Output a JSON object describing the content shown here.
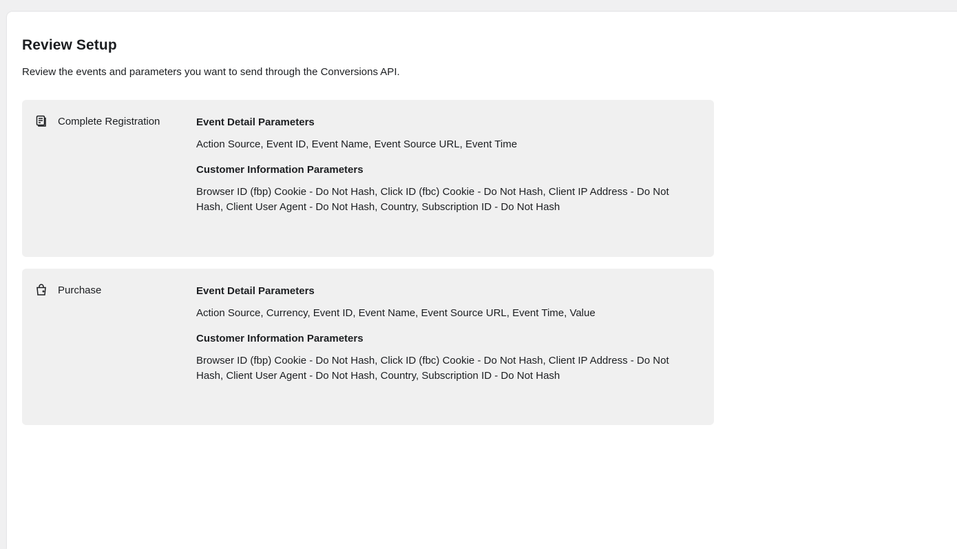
{
  "page": {
    "title": "Review Setup",
    "subtitle": "Review the events and parameters you want to send through the Conversions API."
  },
  "events": [
    {
      "name": "Complete Registration",
      "icon": "registration-form-icon",
      "event_detail_heading": "Event Detail Parameters",
      "event_detail_values": "Action Source, Event ID, Event Name, Event Source URL, Event Time",
      "customer_info_heading": "Customer Information Parameters",
      "customer_info_values": "Browser ID (fbp) Cookie - Do Not Hash, Click ID (fbc) Cookie - Do Not Hash, Client IP Address - Do Not Hash, Client User Agent - Do Not Hash, Country, Subscription ID - Do Not Hash"
    },
    {
      "name": "Purchase",
      "icon": "shopping-bag-icon",
      "event_detail_heading": "Event Detail Parameters",
      "event_detail_values": "Action Source, Currency, Event ID, Event Name, Event Source URL, Event Time, Value",
      "customer_info_heading": "Customer Information Parameters",
      "customer_info_values": "Browser ID (fbp) Cookie - Do Not Hash, Click ID (fbc) Cookie - Do Not Hash, Client IP Address - Do Not Hash, Client User Agent - Do Not Hash, Country, Subscription ID - Do Not Hash"
    }
  ],
  "colors": {
    "page_background": "#f0f0f1",
    "panel_background": "#ffffff",
    "card_background": "#f0f0f0",
    "text": "#1c1e21"
  }
}
